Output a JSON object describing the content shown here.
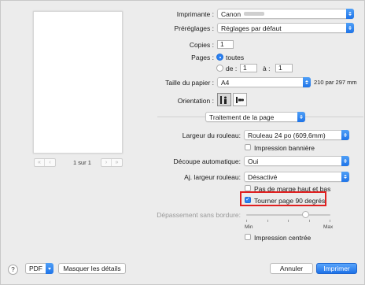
{
  "preview": {
    "page_count": "1 sur 1",
    "nav": {
      "first": "«",
      "prev": "‹",
      "next": "›",
      "last": "»"
    }
  },
  "printer": {
    "label": "Imprimante :",
    "value": "Canon"
  },
  "presets": {
    "label": "Préréglages :",
    "value": "Réglages par défaut"
  },
  "copies": {
    "label": "Copies :",
    "value": "1"
  },
  "pages": {
    "label": "Pages :",
    "all_label": "toutes",
    "from_label": "de :",
    "from_value": "1",
    "to_label": "à :",
    "to_value": "1",
    "selected": "all"
  },
  "paper_size": {
    "label": "Taille du papier :",
    "value": "A4",
    "dims": "210 par 297 mm"
  },
  "orientation": {
    "label": "Orientation :",
    "selected": "portrait"
  },
  "section": {
    "value": "Traitement de la page"
  },
  "roll_width": {
    "label": "Largeur du rouleau:",
    "value": "Rouleau 24 po (609,6mm)"
  },
  "banner": {
    "label": "Impression bannière",
    "checked": false
  },
  "auto_cut": {
    "label": "Découpe automatique:",
    "value": "Oui"
  },
  "fit_roll": {
    "label": "Aj. largeur rouleau:",
    "value": "Désactivé"
  },
  "no_margin": {
    "label": "Pas de marge haut et bas",
    "checked": false
  },
  "rotate": {
    "label": "Tourner page 90 degrés",
    "checked": true
  },
  "borderless": {
    "label": "Dépassement sans bordure:",
    "min_label": "Min",
    "max_label": "Max",
    "level": 0.67
  },
  "centered": {
    "label": "Impression centrée",
    "checked": false
  },
  "footer": {
    "help": "?",
    "pdf": "PDF",
    "details": "Masquer les détails",
    "cancel": "Annuler",
    "print": "Imprimer"
  }
}
